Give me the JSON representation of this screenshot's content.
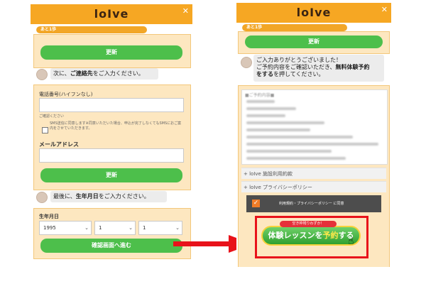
{
  "app": {
    "logo": "loIve",
    "close_icon": "close-icon"
  },
  "left": {
    "progress": {
      "label": "あと1歩",
      "fraction": 0.82
    },
    "update_label": "更新",
    "msg_contact": {
      "prefix": "次に、",
      "bold": "ご連絡先",
      "suffix": "をご入力ください。"
    },
    "phone_label": "電話番号(ハイフンなし)",
    "confirm_title": "ご確認ください",
    "sms_note": "SMS送信に同意します※同意いただいた場合、申込が完了しなくてもSMSにおご案内をさせていただきます。",
    "email_label": "メールアドレス",
    "update_label2": "更新",
    "msg_birth": {
      "prefix": "最後に、",
      "bold": "生年月日",
      "suffix": "をご入力ください。"
    },
    "birth_label": "生年月日",
    "birth_values": {
      "year": "1995",
      "month": "1",
      "day": "1"
    },
    "confirm_button": "確認画面へ進む"
  },
  "right": {
    "progress": {
      "label": "あと1歩",
      "fraction": 0.82
    },
    "update_label": "更新",
    "thanks_line1": "ご入力ありがとうございました！",
    "thanks_line2": "ご予約内容をご確認いただき、",
    "thanks_bold": "無料体験予約",
    "thanks_line3_bold": "をする",
    "thanks_line3": "を押してください。",
    "summary_title": "■ご予約内容■",
    "policy1": "+ loIve 施設利用約款",
    "policy2": "+ loIve プライバシーポリシー",
    "agree_text": "利用規約・プライバシーポリシー に同意",
    "badge": "空き枠残りわずか！",
    "reserve": {
      "pre": "体験レッスンを",
      "hl": "予約",
      "post": "する"
    }
  },
  "colors": {
    "header": "#f6a723",
    "green": "#4dbf4b",
    "red": "#e8121a",
    "cream": "#fde7c0"
  }
}
